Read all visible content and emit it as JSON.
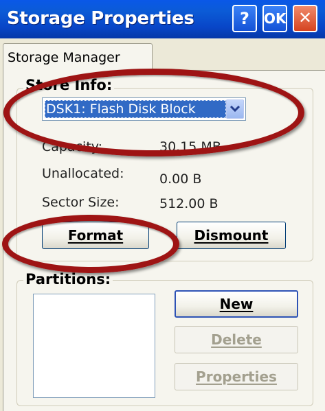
{
  "window": {
    "title": "Storage Properties",
    "help_label": "?",
    "ok_label": "OK",
    "close_label": "✕",
    "close_icon": "close-icon"
  },
  "tabs": [
    {
      "label": "Storage Manager",
      "active": true
    }
  ],
  "store_info": {
    "group_label": "Store Info:",
    "selected_store": "DSK1: Flash Disk Block",
    "dropdown_icon": "chevron-down-icon",
    "dropdown_arrow": "⌄",
    "capacity_label": "Capacity:",
    "capacity_value": "30.15 MB",
    "unallocated_label": "Unallocated:",
    "unallocated_value": "0.00 B",
    "sector_size_label": "Sector Size:",
    "sector_size_value": "512.00 B",
    "format_label": "Format",
    "dismount_label": "Dismount"
  },
  "partitions": {
    "group_label": "Partitions:",
    "items": [],
    "new_label": "New",
    "delete_label": "Delete",
    "properties_label": "Properties",
    "delete_enabled": false,
    "properties_enabled": false
  },
  "annotations": {
    "color": "#9e1414",
    "highlighted": [
      "store-select",
      "format-button"
    ]
  },
  "colors": {
    "titlebar": "#0846c8",
    "selection": "#316ac5",
    "face": "#ece9d8"
  }
}
